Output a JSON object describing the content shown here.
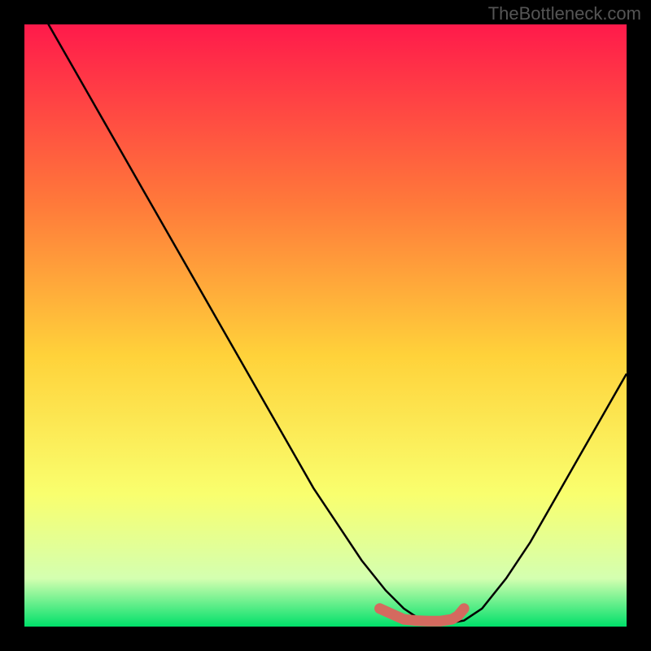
{
  "watermark": "TheBottleneck.com",
  "colors": {
    "bg": "#000000",
    "curve": "#000000",
    "marker": "#d46a5f",
    "grad_top": "#ff1a4b",
    "grad_mid1": "#ff7a3a",
    "grad_mid2": "#ffd23a",
    "grad_mid3": "#f9ff6e",
    "grad_mid4": "#d4ffb0",
    "grad_bot": "#00e06a"
  },
  "chart_data": {
    "type": "line",
    "title": "",
    "xlabel": "",
    "ylabel": "",
    "xlim": [
      0,
      100
    ],
    "ylim": [
      0,
      100
    ],
    "series": [
      {
        "name": "curve",
        "x": [
          0,
          4,
          8,
          12,
          16,
          20,
          24,
          28,
          32,
          36,
          40,
          44,
          48,
          52,
          56,
          60,
          63,
          66,
          70,
          73,
          76,
          80,
          84,
          88,
          92,
          96,
          100
        ],
        "values": [
          118,
          100,
          93,
          86,
          79,
          72,
          65,
          58,
          51,
          44,
          37,
          30,
          23,
          17,
          11,
          6,
          3,
          1,
          0.5,
          1,
          3,
          8,
          14,
          21,
          28,
          35,
          42
        ]
      }
    ],
    "markers": {
      "name": "highlight",
      "x": [
        59,
        63,
        65,
        67,
        69,
        71,
        72,
        73
      ],
      "values": [
        3,
        1.2,
        1.0,
        0.9,
        0.9,
        1.2,
        1.8,
        3.0
      ]
    }
  }
}
